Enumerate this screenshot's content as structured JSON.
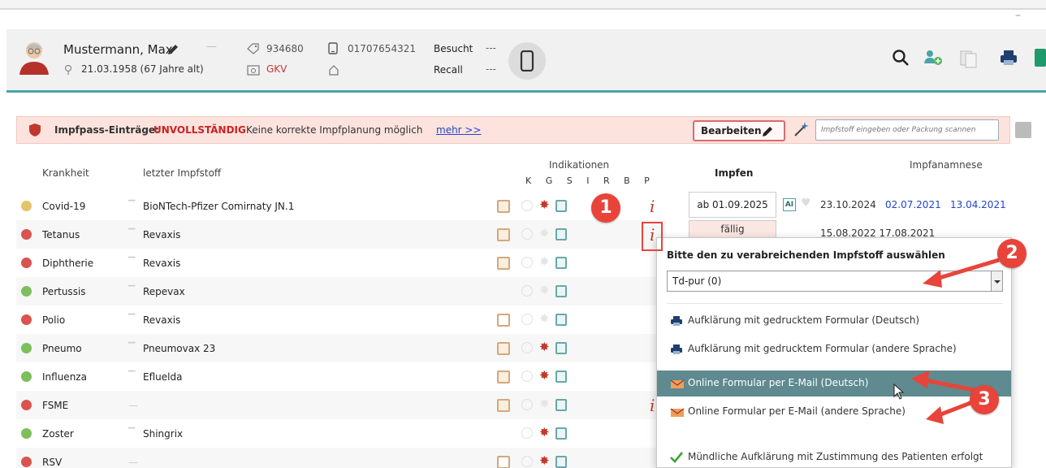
{
  "window": {
    "minimize": "–"
  },
  "patient": {
    "name": "Mustermann, Max",
    "dash": "—",
    "dob": "21.03.1958  (67 Jahre alt)",
    "id": "934680",
    "insurance": "GKV",
    "phone": "01707654321",
    "visited_label": "Besucht",
    "visited_value": "---",
    "recall_label": "Recall",
    "recall_value": "---"
  },
  "banner": {
    "label": "Impfpass-Einträge:",
    "status": "UNVOLLSTÄNDIG",
    "text": "Keine korrekte Impfplanung möglich",
    "link": "mehr >>",
    "edit_button": "Bearbeiten",
    "input_placeholder": "Impfstoff eingeben oder Packung scannen"
  },
  "table": {
    "col_disease": "Krankheit",
    "col_vaccine": "letzter Impfstoff",
    "col_indications": "Indikationen",
    "indication_letters": "K G S  I R B P",
    "col_impfen": "Impfen",
    "col_anamnese": "Impfanamnese",
    "rows": [
      {
        "disease": "Covid-19",
        "vaccine": "BioNTech-Pfizer Comirnaty JN.1"
      },
      {
        "disease": "Tetanus",
        "vaccine": "Revaxis"
      },
      {
        "disease": "Diphtherie",
        "vaccine": "Revaxis"
      },
      {
        "disease": "Pertussis",
        "vaccine": "Repevax"
      },
      {
        "disease": "Polio",
        "vaccine": "Revaxis"
      },
      {
        "disease": "Pneumo",
        "vaccine": "Pneumovax 23"
      },
      {
        "disease": "Influenza",
        "vaccine": "Efluelda"
      },
      {
        "disease": "FSME",
        "vaccine": "—"
      },
      {
        "disease": "Zoster",
        "vaccine": "Shingrix"
      },
      {
        "disease": "RSV",
        "vaccine": "—"
      }
    ],
    "covid_due": "ab 01.09.2025",
    "covid_ai": "AI",
    "covid_dates": [
      "23.10.2024",
      "02.07.2021",
      "13.04.2021"
    ],
    "tetanus_due": "fällig",
    "tetanus_dates": "15.08.2022  17.08.2021"
  },
  "popup": {
    "title": "Bitte den zu verabreichenden Impfstoff auswählen",
    "selected": "Td-pur (0)",
    "items": [
      "Aufklärung mit gedrucktem Formular (Deutsch)",
      "Aufklärung mit gedrucktem Formular (andere Sprache)",
      "Online Formular per E-Mail (Deutsch)",
      "Online Formular per E-Mail (andere Sprache)",
      "Mündliche Aufklärung mit Zustimmung des Patienten erfolgt"
    ]
  },
  "callouts": {
    "c1": "1",
    "c2": "2",
    "c3": "3"
  },
  "colors": {
    "accent": "#4aa3a8",
    "alert": "#cc2222",
    "highlight": "#5f8a8f",
    "callout": "#e8443a"
  }
}
